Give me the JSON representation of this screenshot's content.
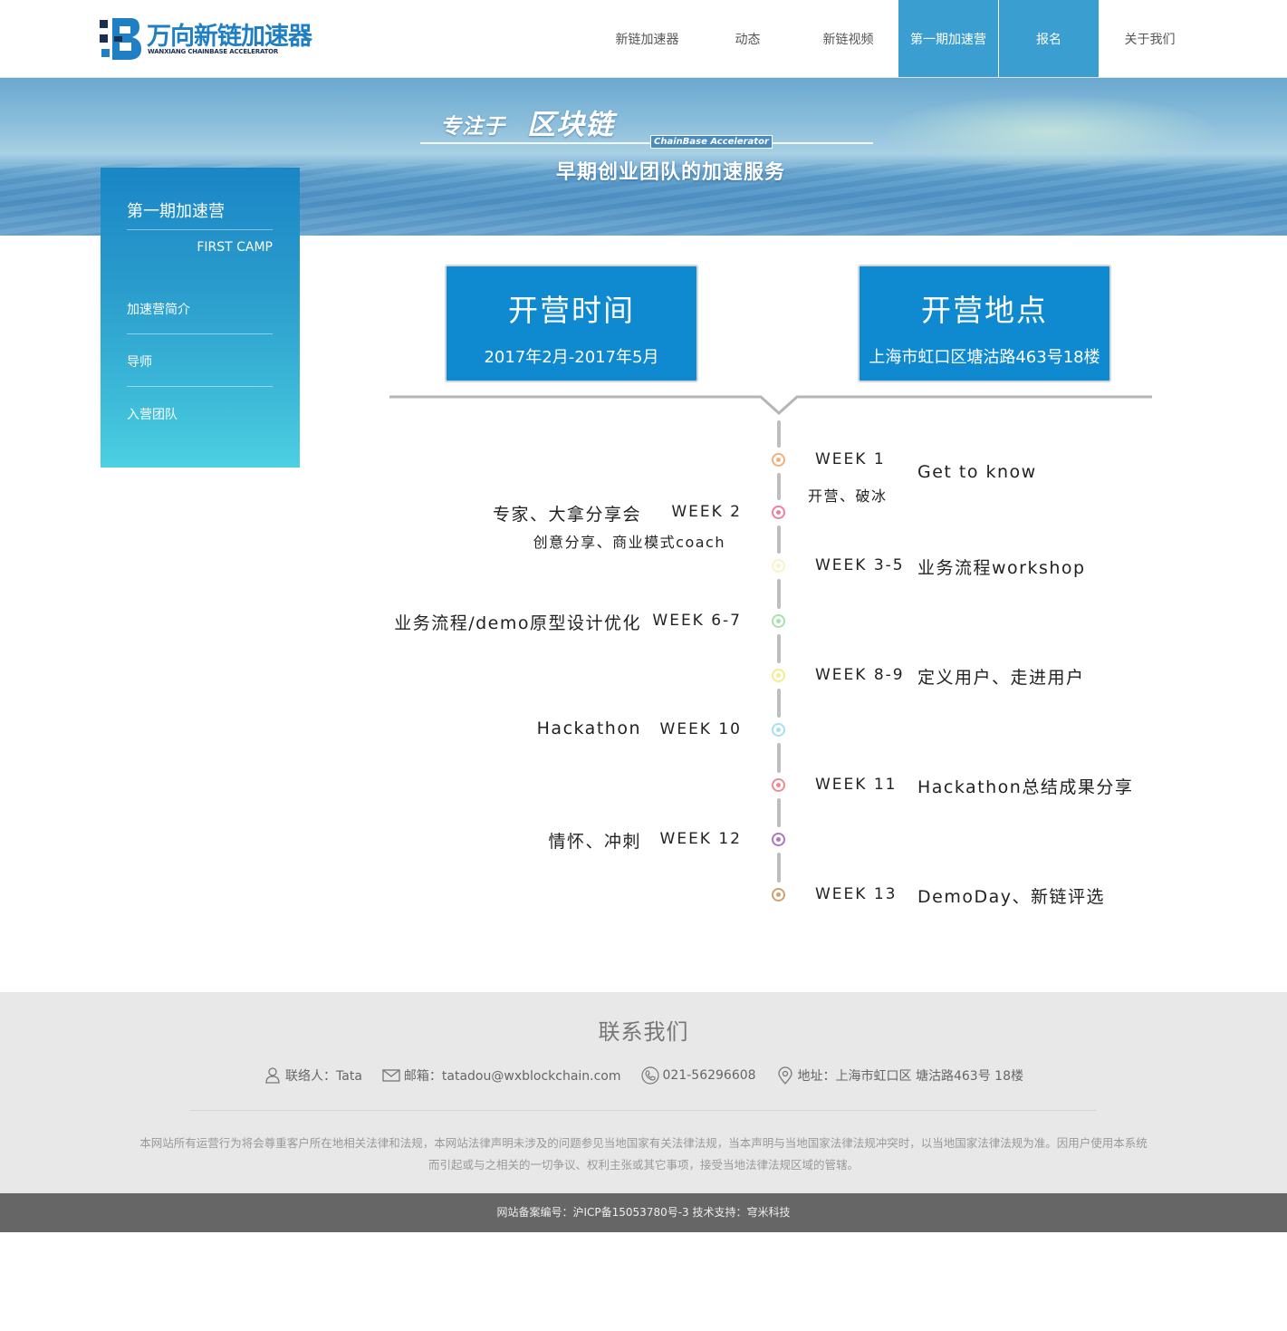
{
  "brand": {
    "title": "万向新链加速器",
    "subtitle": "WANXIANG CHAINBASE ACCELERATOR",
    "primary_color": "#1f7fc4",
    "accent_color": "#3a9ed0"
  },
  "nav": {
    "items": [
      {
        "label": "新链加速器"
      },
      {
        "label": "动态"
      },
      {
        "label": "新链视频"
      },
      {
        "label": "第一期加速营",
        "active": true
      },
      {
        "label": "报名",
        "active": true
      },
      {
        "label": "关于我们"
      }
    ]
  },
  "banner": {
    "slogan_prefix": "专注于",
    "slogan_main": "区块链",
    "tag": "ChainBase Accelerator",
    "slogan_sub": "早期创业团队的加速服务"
  },
  "sidebar": {
    "title": "第一期加速营",
    "subtitle": "FIRST CAMP",
    "links": [
      {
        "label": "加速营简介"
      },
      {
        "label": "导师"
      },
      {
        "label": "入营团队"
      }
    ]
  },
  "info": {
    "time_title": "开营时间",
    "time_value": "2017年2月-2017年5月",
    "place_title": "开营地点",
    "place_value": "上海市虹口区塘沽路463号18楼"
  },
  "timeline": [
    {
      "week": "WEEK 1",
      "side": "right",
      "event": "Get to know",
      "note": "开营、破冰",
      "color": "#f3b07a"
    },
    {
      "week": "WEEK 2",
      "side": "left",
      "event": "专家、大拿分享会",
      "note": "创意分享、商业模式coach",
      "color": "#ef7fa0"
    },
    {
      "week": "WEEK 3-5",
      "side": "right",
      "event": "业务流程workshop",
      "color": "#f7f4c8"
    },
    {
      "week": "WEEK 6-7",
      "side": "left",
      "event": "业务流程/demo原型设计优化",
      "color": "#a7e2a8"
    },
    {
      "week": "WEEK 8-9",
      "side": "right",
      "event": "定义用户、走进用户",
      "color": "#f5ec8d"
    },
    {
      "week": "WEEK 10",
      "side": "left",
      "event": "Hackathon",
      "color": "#a9dff0"
    },
    {
      "week": "WEEK 11",
      "side": "right",
      "event": "Hackathon总结成果分享",
      "color": "#ef8a94"
    },
    {
      "week": "WEEK 12",
      "side": "left",
      "event": "情怀、冲刺",
      "color": "#a978c4"
    },
    {
      "week": "WEEK 13",
      "side": "right",
      "event": "DemoDay、新链评选",
      "color": "#d0a272"
    }
  ],
  "footer": {
    "title": "联系我们",
    "contact_label": "联络人：Tata",
    "email_label": "邮箱：tatadou@wxblockchain.com",
    "phone_label": "021-56296608",
    "address_label": "地址：上海市虹口区 塘沽路463号 18楼",
    "legal_line1": "本网站所有运营行为将会尊重客户所在地相关法律和法规，本网站法律声明未涉及的问题参见当地国家有关法律法规，当本声明与当地国家法律法规冲突时，以当地国家法律法规为准。因用户使用本系统",
    "legal_line2": "而引起或与之相关的一切争议、权利主张或其它事项，接受当地法律法规区域的管辖。",
    "record": "网站备案编号：沪ICP备15053780号-3 技术支持：穹米科技"
  }
}
